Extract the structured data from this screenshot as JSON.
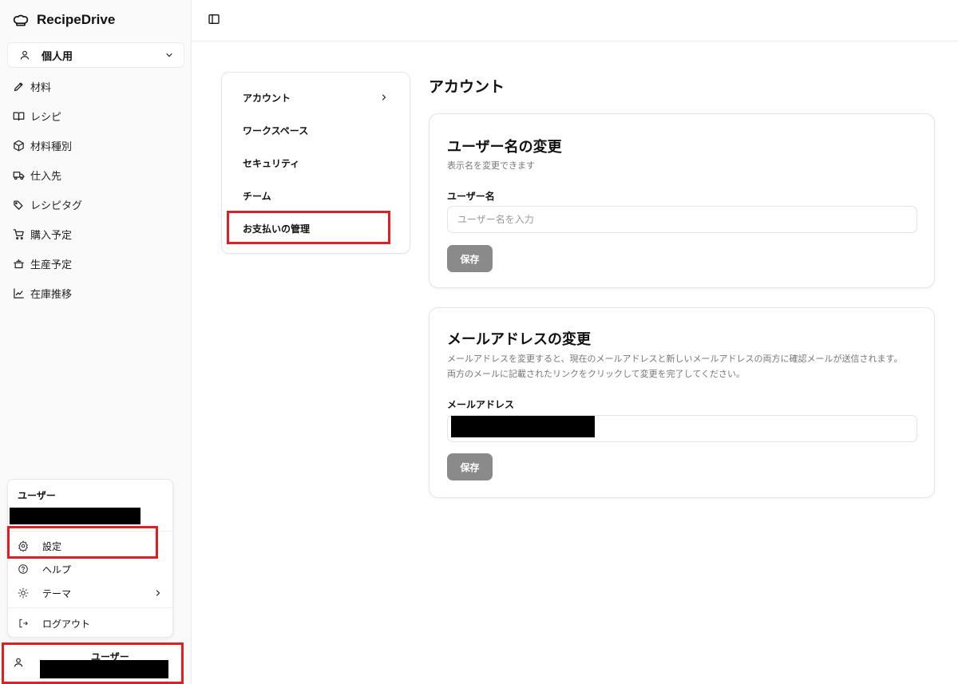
{
  "app": {
    "name": "RecipeDrive"
  },
  "sidebar": {
    "workspace": "個人用",
    "items": [
      {
        "label": "材料",
        "icon": "pencil-icon"
      },
      {
        "label": "レシピ",
        "icon": "book-icon"
      },
      {
        "label": "材料種別",
        "icon": "box-icon"
      },
      {
        "label": "仕入先",
        "icon": "truck-icon"
      },
      {
        "label": "レシピタグ",
        "icon": "tags-icon"
      },
      {
        "label": "購入予定",
        "icon": "cart-icon"
      },
      {
        "label": "生産予定",
        "icon": "cooking-pot-icon"
      },
      {
        "label": "在庫推移",
        "icon": "line-chart-icon"
      }
    ]
  },
  "user_menu": {
    "title": "ユーザー",
    "settings": "設定",
    "help": "ヘルプ",
    "theme": "テーマ",
    "logout": "ログアウト"
  },
  "user_footer": {
    "title": "ユーザー"
  },
  "settings_nav": {
    "items": [
      "アカウント",
      "ワークスペース",
      "セキュリティ",
      "チーム",
      "お支払いの管理"
    ],
    "active": "アカウント"
  },
  "account": {
    "title": "アカウント",
    "username_card": {
      "title": "ユーザー名の変更",
      "description": "表示名を変更できます",
      "label": "ユーザー名",
      "placeholder": "ユーザー名を入力",
      "save": "保存"
    },
    "email_card": {
      "title": "メールアドレスの変更",
      "description_1": "メールアドレスを変更すると、現在のメールアドレスと新しいメールアドレスの両方に確認メールが送信されます。",
      "description_2": "両方のメールに記載されたリンクをクリックして変更を完了してください。",
      "label": "メールアドレス",
      "save": "保存"
    }
  },
  "colors": {
    "highlight": "#e02020",
    "button": "#8a8a8a",
    "redaction": "#000000"
  }
}
